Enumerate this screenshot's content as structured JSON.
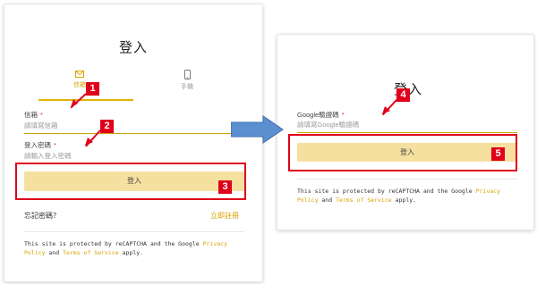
{
  "left_form": {
    "title": "登入",
    "tabs": [
      {
        "label": "信箱",
        "icon": "envelope-icon",
        "active": true
      },
      {
        "label": "手機",
        "icon": "phone-icon",
        "active": false
      }
    ],
    "email_label": "信箱",
    "email_placeholder": "請填寫信箱",
    "password_label": "登入密碼",
    "password_placeholder": "請輸入登入密碼",
    "required_mark": "*",
    "submit_label": "登入",
    "forgot_password": "忘記密碼？",
    "register_now": "立即註冊",
    "recaptcha": {
      "pre": "This site is protected by reCAPTCHA and the Google ",
      "privacy": "Privacy Policy",
      "and": " and ",
      "terms": "Terms of Service",
      "post": " apply."
    }
  },
  "right_form": {
    "title": "登入",
    "code_label": "Google驗證碼",
    "code_placeholder": "請填寫Google驗證碼",
    "required_mark": "*",
    "submit_label": "登入",
    "recaptcha": {
      "pre": "This site is protected by reCAPTCHA and the Google ",
      "privacy": "Privacy Policy",
      "and": " and ",
      "terms": "Terms of Service",
      "post": " apply."
    }
  },
  "annotations": [
    "1",
    "2",
    "3",
    "4",
    "5"
  ],
  "colors": {
    "accent": "#d9a300",
    "button": "#f6e0a0",
    "highlight": "#e0001a",
    "flow_arrow": "#5b8fd0"
  }
}
